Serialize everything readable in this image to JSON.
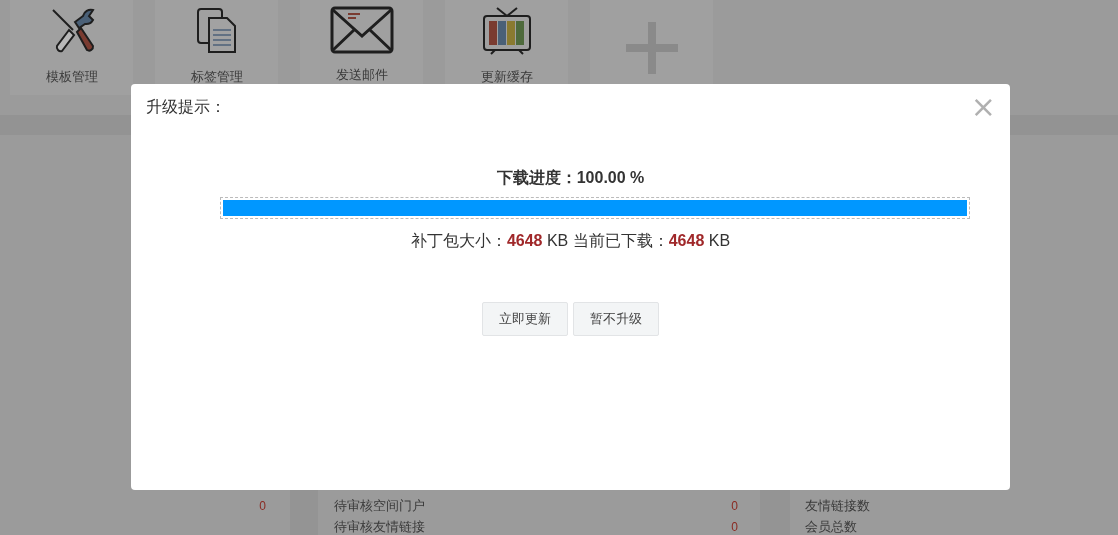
{
  "shortcuts": [
    {
      "label": "模板管理",
      "kind": "tools"
    },
    {
      "label": "标签管理",
      "kind": "documents"
    },
    {
      "label": "发送邮件",
      "kind": "mail"
    },
    {
      "label": "更新缓存",
      "kind": "tv"
    },
    {
      "kind": "add"
    }
  ],
  "left_panel": {
    "value": "0"
  },
  "middle_panel": {
    "rows": [
      {
        "label": "待审核空间门户",
        "value": "0"
      },
      {
        "label": "待审核友情链接",
        "value": "0"
      }
    ]
  },
  "right_panel": {
    "rows": [
      {
        "label": "友情链接数"
      },
      {
        "label": "会员总数"
      }
    ]
  },
  "dialog": {
    "title": "升级提示：",
    "close": "×",
    "progress_label": "下载进度：100.00 %",
    "progress": {
      "level": 1
    },
    "info": "补丁包大小：**4648** KB 当前已下载：**4648** KB",
    "buttons": [
      {
        "label": "立即更新"
      },
      {
        "label": "暂不升级"
      }
    ]
  }
}
